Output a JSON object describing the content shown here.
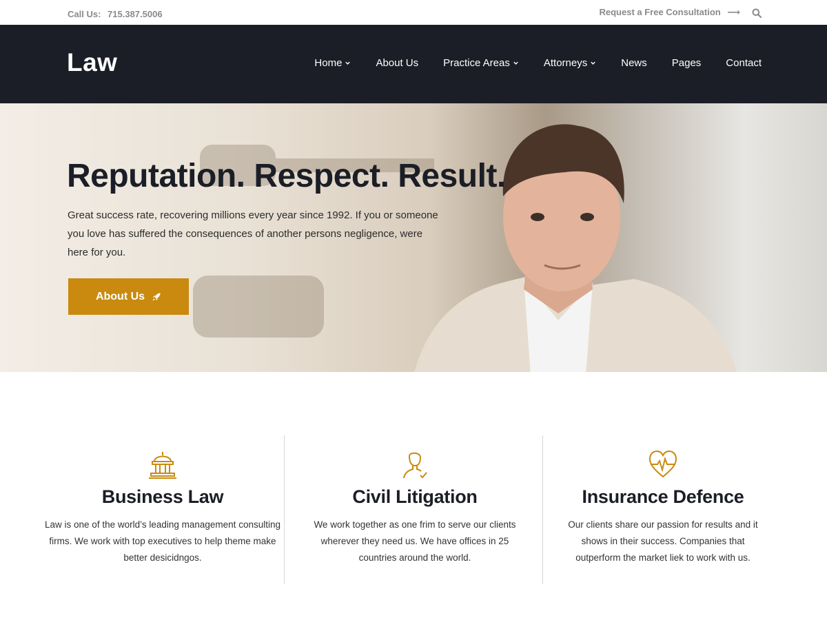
{
  "topbar": {
    "call_label": "Call Us:",
    "phone": "715.387.5006",
    "consultation_link": "Request a Free Consultation",
    "arrow_glyph": "⟶",
    "search_icon": "search-icon"
  },
  "header": {
    "logo": "Law",
    "nav": [
      {
        "label": "Home",
        "dropdown": true
      },
      {
        "label": "About Us",
        "dropdown": false
      },
      {
        "label": "Practice Areas",
        "dropdown": true
      },
      {
        "label": "Attorneys",
        "dropdown": true
      },
      {
        "label": "News",
        "dropdown": false
      },
      {
        "label": "Pages",
        "dropdown": false
      },
      {
        "label": "Contact",
        "dropdown": false
      }
    ]
  },
  "hero": {
    "title": "Reputation. Respect. Result.",
    "text": "Great success rate, recovering millions every year since 1992. If you or someone you love has suffered the consequences of another persons negligence, were here for you.",
    "button_label": "About Us",
    "button_icon": "rocket-icon"
  },
  "features": [
    {
      "icon": "courthouse-icon",
      "title": "Business Law",
      "text": "Law is one of the world’s leading management consulting firms. We work with top executives to help theme make better desicidngos."
    },
    {
      "icon": "person-check-icon",
      "title": "Civil Litigation",
      "text": "We work together as one frim to serve our clients wherever they need us. We have offices in 25 countries around the world."
    },
    {
      "icon": "heart-pulse-icon",
      "title": "Insurance Defence",
      "text": "Our clients share our passion for results and it shows in their success. Companies that outperform the market liek to work with us."
    }
  ],
  "colors": {
    "accent": "#c98a0f",
    "header_bg": "#1b1e26",
    "muted_text": "#8a8a8a"
  }
}
